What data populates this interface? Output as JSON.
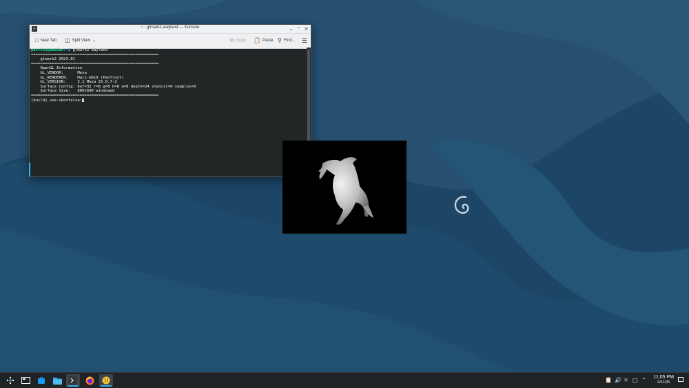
{
  "konsole": {
    "title": "~ : glmark2-wayland — Konsole",
    "toolbar": {
      "new_tab": "New Tab",
      "split_view": "Split View",
      "copy": "Copy",
      "paste": "Paste",
      "find": "Find..."
    },
    "terminal": {
      "prompt_user": "patrick@debian",
      "prompt_path": ":~$",
      "command": " glmark2-wayland",
      "lines": [
        "=======================================================",
        "    glmark2 2023.01",
        "=======================================================",
        "    OpenGL Information",
        "    GL_VENDOR:      Mesa",
        "    GL_RENDERER:    Mali-G610 (Panfrost)",
        "    GL_VERSION:     3.1 Mesa 25.0.7-2",
        "    Surface Config: buf=32 r=8 g=8 b=8 a=8 depth=24 stencil=0 samples=0",
        "    Surface Size:   800x600 windowed",
        "======================================================="
      ],
      "last_line": "[build] use-vbo=false:"
    }
  },
  "taskbar": {
    "clock_time": "11:05 PM",
    "clock_date": "9/11/25"
  },
  "colors": {
    "accent": "#3daee9",
    "prompt_user": "#1cdc9a",
    "terminal_bg": "#232627"
  }
}
